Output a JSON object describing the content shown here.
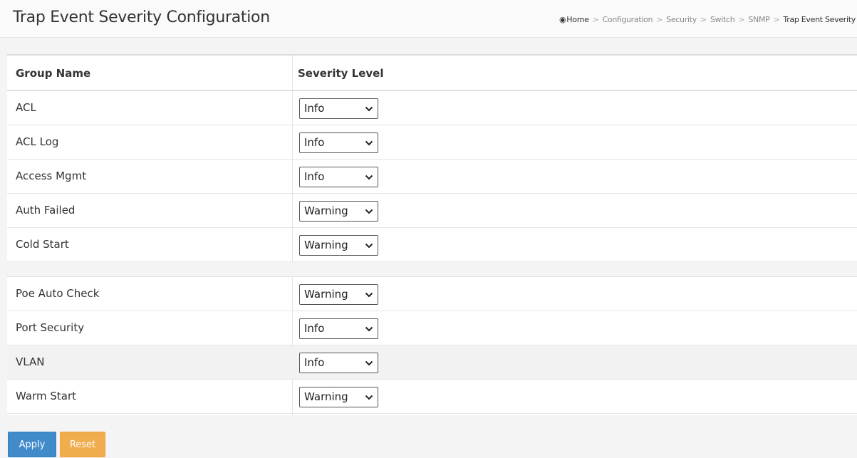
{
  "header": {
    "title": "Trap Event Severity Configuration",
    "breadcrumb": [
      "Home",
      "Configuration",
      "Security",
      "Switch",
      "SNMP",
      "Trap Event Severity"
    ]
  },
  "table": {
    "headers": [
      "Group Name",
      "Severity Level"
    ],
    "rows_top": [
      {
        "group": "ACL",
        "severity": "Info"
      },
      {
        "group": "ACL Log",
        "severity": "Info"
      },
      {
        "group": "Access Mgmt",
        "severity": "Info"
      },
      {
        "group": "Auth Failed",
        "severity": "Warning"
      },
      {
        "group": "Cold Start",
        "severity": "Warning"
      }
    ],
    "rows_bottom": [
      {
        "group": "Poe Auto Check",
        "severity": "Warning"
      },
      {
        "group": "Port Security",
        "severity": "Info"
      },
      {
        "group": "VLAN",
        "severity": "Info"
      },
      {
        "group": "Warm Start",
        "severity": "Warning"
      }
    ]
  },
  "buttons": {
    "apply": "Apply",
    "reset": "Reset"
  },
  "colors": {
    "apply": "#428bca",
    "reset": "#f0ad4e"
  }
}
